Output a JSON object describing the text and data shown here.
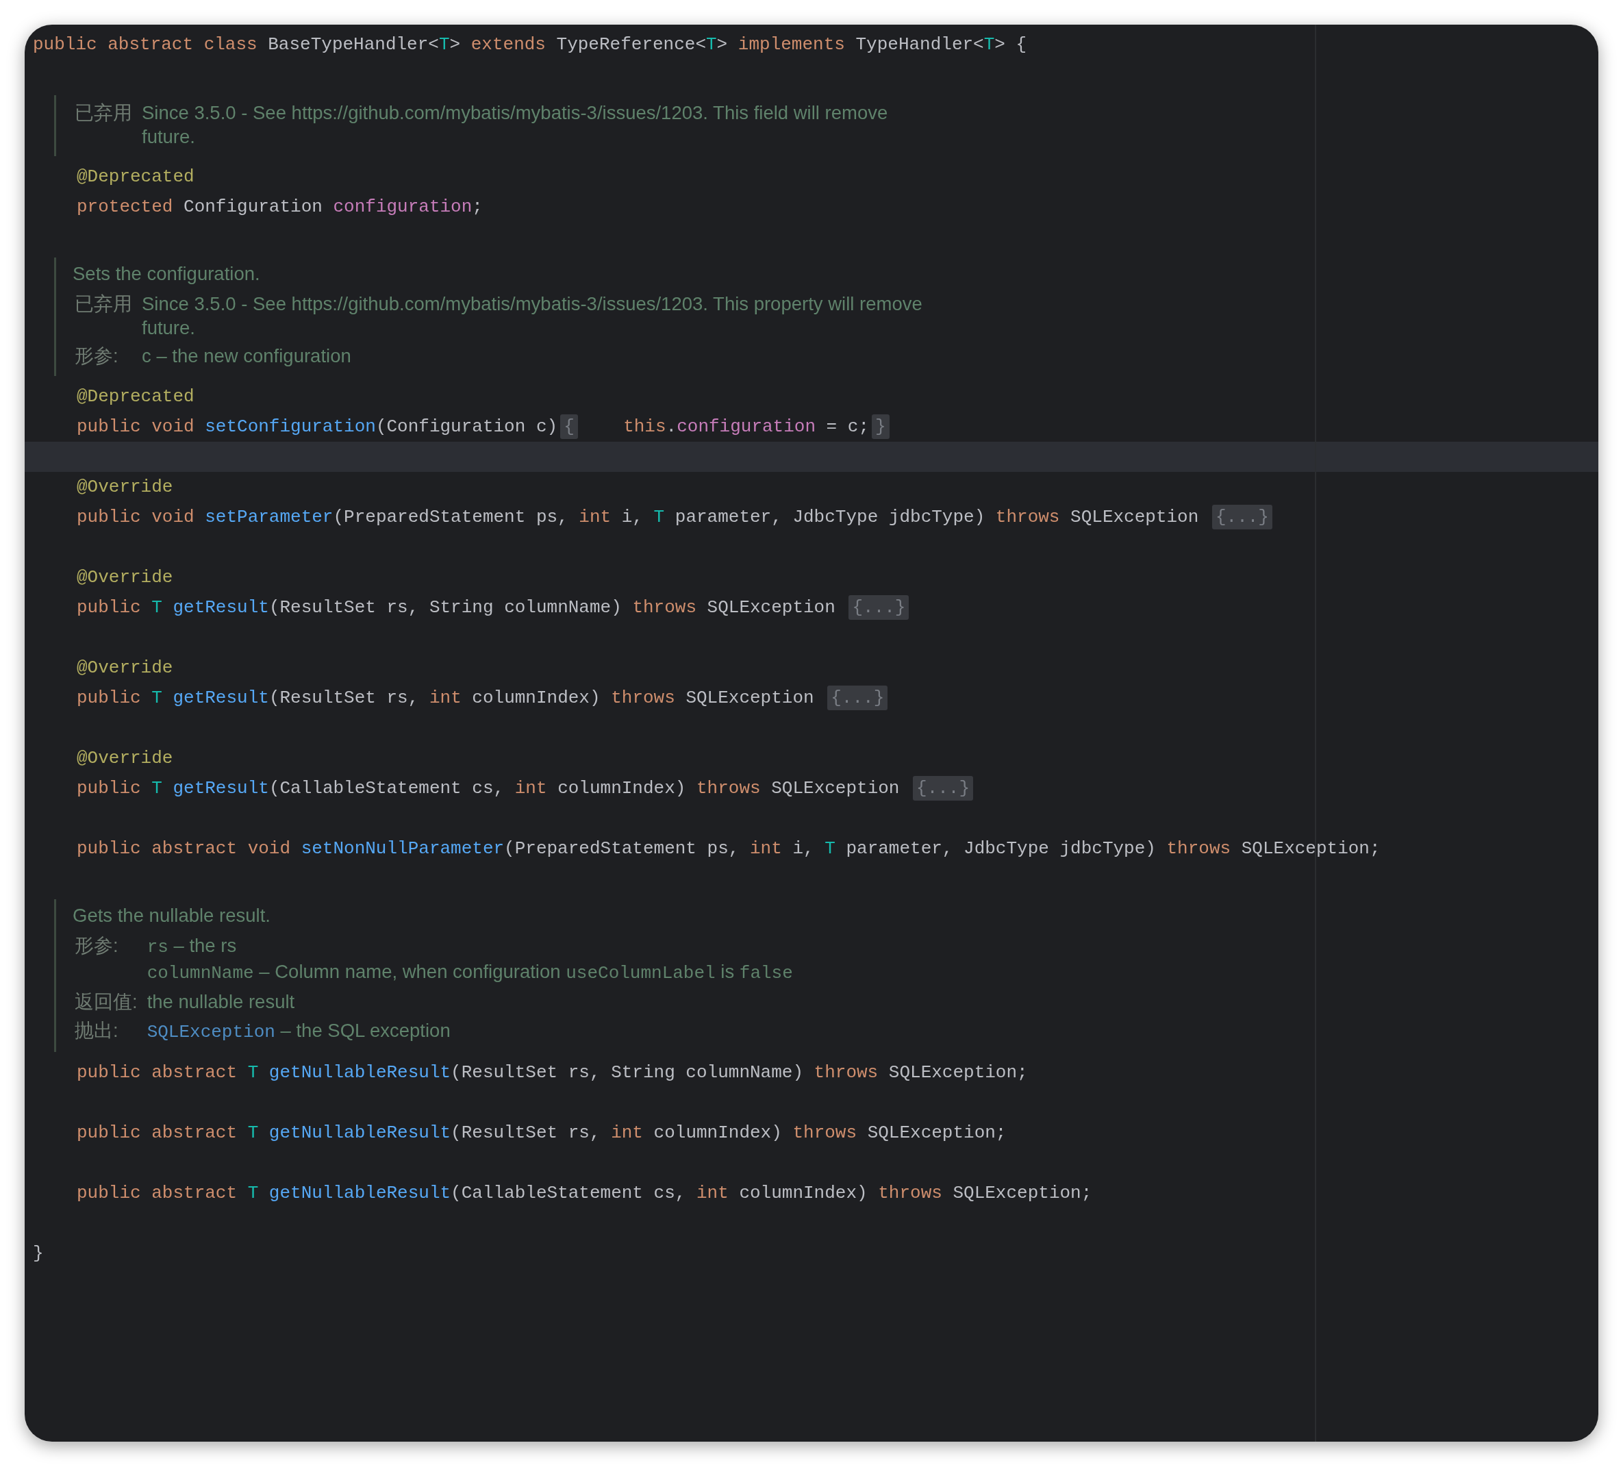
{
  "editor": {
    "class_header": {
      "tokens": [
        {
          "kind": "keyword",
          "text": "public abstract class "
        },
        {
          "kind": "plain",
          "text": "BaseTypeHandler<"
        },
        {
          "kind": "type_param",
          "text": "T"
        },
        {
          "kind": "plain",
          "text": "> "
        },
        {
          "kind": "keyword",
          "text": "extends "
        },
        {
          "kind": "plain",
          "text": "TypeReference<"
        },
        {
          "kind": "type_param",
          "text": "T"
        },
        {
          "kind": "plain",
          "text": "> "
        },
        {
          "kind": "keyword",
          "text": "implements "
        },
        {
          "kind": "plain",
          "text": "TypeHandler<"
        },
        {
          "kind": "type_param",
          "text": "T"
        },
        {
          "kind": "plain",
          "text": "> {"
        }
      ]
    },
    "body": [
      {
        "kind": "blank"
      },
      {
        "kind": "doc",
        "tags": [
          {
            "label": "已弃用",
            "entries": [
              {
                "lines": [
                  {
                    "parts": [
                      {
                        "kind": "text",
                        "text": "Since 3.5.0 - See https://github.com/mybatis/mybatis-3/issues/1203. This field will remove"
                      }
                    ]
                  },
                  {
                    "parts": [
                      {
                        "kind": "text",
                        "text": "future."
                      }
                    ]
                  }
                ]
              }
            ]
          }
        ]
      },
      {
        "kind": "code",
        "tokens": [
          {
            "kind": "annotation",
            "text": "@Deprecated"
          }
        ]
      },
      {
        "kind": "code",
        "tokens": [
          {
            "kind": "keyword",
            "text": "protected "
          },
          {
            "kind": "plain",
            "text": "Configuration "
          },
          {
            "kind": "field",
            "text": "configuration"
          },
          {
            "kind": "plain",
            "text": ";"
          }
        ]
      },
      {
        "kind": "blank"
      },
      {
        "kind": "doc",
        "description": "Sets the configuration.",
        "tags": [
          {
            "label": "已弃用",
            "entries": [
              {
                "lines": [
                  {
                    "parts": [
                      {
                        "kind": "text",
                        "text": "Since 3.5.0 - See https://github.com/mybatis/mybatis-3/issues/1203. This property will remove"
                      }
                    ]
                  },
                  {
                    "parts": [
                      {
                        "kind": "text",
                        "text": "future."
                      }
                    ]
                  }
                ]
              }
            ]
          },
          {
            "label": "形参:",
            "entries": [
              {
                "lines": [
                  {
                    "parts": [
                      {
                        "kind": "text",
                        "text": "c – the new configuration"
                      }
                    ]
                  }
                ]
              }
            ]
          }
        ]
      },
      {
        "kind": "code",
        "tokens": [
          {
            "kind": "annotation",
            "text": "@Deprecated"
          }
        ]
      },
      {
        "kind": "code",
        "tokens": [
          {
            "kind": "keyword",
            "text": "public void "
          },
          {
            "kind": "method",
            "text": "setConfiguration"
          },
          {
            "kind": "plain",
            "text": "(Configuration c)"
          },
          {
            "kind": "fold",
            "text": "{"
          },
          {
            "kind": "keyword",
            "text": "    this"
          },
          {
            "kind": "plain",
            "text": "."
          },
          {
            "kind": "field",
            "text": "configuration"
          },
          {
            "kind": "plain",
            "text": " = c;"
          },
          {
            "kind": "fold",
            "text": "}"
          }
        ]
      },
      {
        "kind": "current_line"
      },
      {
        "kind": "code",
        "tokens": [
          {
            "kind": "annotation",
            "text": "@Override"
          }
        ]
      },
      {
        "kind": "code",
        "tokens": [
          {
            "kind": "keyword",
            "text": "public void "
          },
          {
            "kind": "method",
            "text": "setParameter"
          },
          {
            "kind": "plain",
            "text": "(PreparedStatement ps, "
          },
          {
            "kind": "keyword",
            "text": "int "
          },
          {
            "kind": "plain",
            "text": "i, "
          },
          {
            "kind": "type_param",
            "text": "T "
          },
          {
            "kind": "plain",
            "text": "parameter, JdbcType jdbcType) "
          },
          {
            "kind": "keyword",
            "text": "throws "
          },
          {
            "kind": "plain",
            "text": "SQLException "
          },
          {
            "kind": "fold",
            "text": "{...}"
          }
        ]
      },
      {
        "kind": "blank"
      },
      {
        "kind": "code",
        "tokens": [
          {
            "kind": "annotation",
            "text": "@Override"
          }
        ]
      },
      {
        "kind": "code",
        "tokens": [
          {
            "kind": "keyword",
            "text": "public "
          },
          {
            "kind": "type_param",
            "text": "T "
          },
          {
            "kind": "method",
            "text": "getResult"
          },
          {
            "kind": "plain",
            "text": "(ResultSet rs, String columnName) "
          },
          {
            "kind": "keyword",
            "text": "throws "
          },
          {
            "kind": "plain",
            "text": "SQLException "
          },
          {
            "kind": "fold",
            "text": "{...}"
          }
        ]
      },
      {
        "kind": "blank"
      },
      {
        "kind": "code",
        "tokens": [
          {
            "kind": "annotation",
            "text": "@Override"
          }
        ]
      },
      {
        "kind": "code",
        "tokens": [
          {
            "kind": "keyword",
            "text": "public "
          },
          {
            "kind": "type_param",
            "text": "T "
          },
          {
            "kind": "method",
            "text": "getResult"
          },
          {
            "kind": "plain",
            "text": "(ResultSet rs, "
          },
          {
            "kind": "keyword",
            "text": "int "
          },
          {
            "kind": "plain",
            "text": "columnIndex) "
          },
          {
            "kind": "keyword",
            "text": "throws "
          },
          {
            "kind": "plain",
            "text": "SQLException "
          },
          {
            "kind": "fold",
            "text": "{...}"
          }
        ]
      },
      {
        "kind": "blank"
      },
      {
        "kind": "code",
        "tokens": [
          {
            "kind": "annotation",
            "text": "@Override"
          }
        ]
      },
      {
        "kind": "code",
        "tokens": [
          {
            "kind": "keyword",
            "text": "public "
          },
          {
            "kind": "type_param",
            "text": "T "
          },
          {
            "kind": "method",
            "text": "getResult"
          },
          {
            "kind": "plain",
            "text": "(CallableStatement cs, "
          },
          {
            "kind": "keyword",
            "text": "int "
          },
          {
            "kind": "plain",
            "text": "columnIndex) "
          },
          {
            "kind": "keyword",
            "text": "throws "
          },
          {
            "kind": "plain",
            "text": "SQLException "
          },
          {
            "kind": "fold",
            "text": "{...}"
          }
        ]
      },
      {
        "kind": "blank"
      },
      {
        "kind": "code",
        "tokens": [
          {
            "kind": "keyword",
            "text": "public abstract void "
          },
          {
            "kind": "method",
            "text": "setNonNullParameter"
          },
          {
            "kind": "plain",
            "text": "(PreparedStatement ps, "
          },
          {
            "kind": "keyword",
            "text": "int "
          },
          {
            "kind": "plain",
            "text": "i, "
          },
          {
            "kind": "type_param",
            "text": "T "
          },
          {
            "kind": "plain",
            "text": "parameter, JdbcType jdbcType) "
          },
          {
            "kind": "keyword",
            "text": "throws "
          },
          {
            "kind": "plain",
            "text": "SQLException;"
          }
        ]
      },
      {
        "kind": "blank"
      },
      {
        "kind": "doc",
        "description": "Gets the nullable result.",
        "tags": [
          {
            "label": "形参:",
            "entries": [
              {
                "lines": [
                  {
                    "parts": [
                      {
                        "kind": "code",
                        "text": "rs"
                      },
                      {
                        "kind": "text",
                        "text": "– the rs"
                      }
                    ]
                  },
                  {
                    "parts": [
                      {
                        "kind": "code",
                        "text": "columnName"
                      },
                      {
                        "kind": "text",
                        "text": "– Column name, when configuration"
                      },
                      {
                        "kind": "code",
                        "text": "useColumnLabel"
                      },
                      {
                        "kind": "text",
                        "text": "is"
                      },
                      {
                        "kind": "code",
                        "text": "false"
                      }
                    ]
                  }
                ]
              }
            ]
          },
          {
            "label": "返回值:",
            "entries": [
              {
                "lines": [
                  {
                    "parts": [
                      {
                        "kind": "text",
                        "text": "the nullable result"
                      }
                    ]
                  }
                ]
              }
            ]
          },
          {
            "label": "抛出:",
            "entries": [
              {
                "lines": [
                  {
                    "parts": [
                      {
                        "kind": "link",
                        "text": "SQLException"
                      },
                      {
                        "kind": "text",
                        "text": "– the SQL exception"
                      }
                    ]
                  }
                ]
              }
            ]
          }
        ]
      },
      {
        "kind": "code",
        "tokens": [
          {
            "kind": "keyword",
            "text": "public abstract "
          },
          {
            "kind": "type_param",
            "text": "T "
          },
          {
            "kind": "method",
            "text": "getNullableResult"
          },
          {
            "kind": "plain",
            "text": "(ResultSet rs, String columnName) "
          },
          {
            "kind": "keyword",
            "text": "throws "
          },
          {
            "kind": "plain",
            "text": "SQLException;"
          }
        ]
      },
      {
        "kind": "blank"
      },
      {
        "kind": "code",
        "tokens": [
          {
            "kind": "keyword",
            "text": "public abstract "
          },
          {
            "kind": "type_param",
            "text": "T "
          },
          {
            "kind": "method",
            "text": "getNullableResult"
          },
          {
            "kind": "plain",
            "text": "(ResultSet rs, "
          },
          {
            "kind": "keyword",
            "text": "int "
          },
          {
            "kind": "plain",
            "text": "columnIndex) "
          },
          {
            "kind": "keyword",
            "text": "throws "
          },
          {
            "kind": "plain",
            "text": "SQLException;"
          }
        ]
      },
      {
        "kind": "blank"
      },
      {
        "kind": "code",
        "tokens": [
          {
            "kind": "keyword",
            "text": "public abstract "
          },
          {
            "kind": "type_param",
            "text": "T "
          },
          {
            "kind": "method",
            "text": "getNullableResult"
          },
          {
            "kind": "plain",
            "text": "(CallableStatement cs, "
          },
          {
            "kind": "keyword",
            "text": "int "
          },
          {
            "kind": "plain",
            "text": "columnIndex) "
          },
          {
            "kind": "keyword",
            "text": "throws "
          },
          {
            "kind": "plain",
            "text": "SQLException;"
          }
        ]
      },
      {
        "kind": "blank"
      }
    ],
    "closing": {
      "tokens": [
        {
          "kind": "plain",
          "text": "}"
        }
      ]
    }
  }
}
